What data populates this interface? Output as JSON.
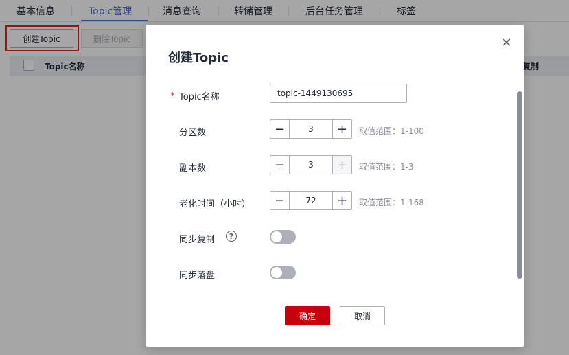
{
  "tabs": [
    {
      "label": "基本信息",
      "active": false
    },
    {
      "label": "Topic管理",
      "active": true
    },
    {
      "label": "消息查询",
      "active": false
    },
    {
      "label": "转储管理",
      "active": false
    },
    {
      "label": "后台任务管理",
      "active": false
    },
    {
      "label": "标签",
      "active": false
    }
  ],
  "toolbar": {
    "create_label": "创建Topic",
    "delete_label": "删除Topic"
  },
  "table": {
    "columns": [
      "Topic名称",
      "复制"
    ]
  },
  "dialog": {
    "title": "创建Topic",
    "close_icon": "close-icon",
    "fields": {
      "name": {
        "label": "Topic名称",
        "value": "topic-1449130695",
        "required": true
      },
      "partitions": {
        "label": "分区数",
        "value": "3",
        "hint": "取值范围：1-100"
      },
      "replicas": {
        "label": "副本数",
        "value": "3",
        "hint": "取值范围：1-3"
      },
      "aging_time": {
        "label": "老化时间（小时）",
        "value": "72",
        "hint": "取值范围：1-168"
      },
      "sync_replication": {
        "label": "同步复制",
        "enabled": false,
        "help_icon": "help-icon"
      },
      "sync_flush": {
        "label": "同步落盘",
        "enabled": false
      }
    },
    "ok_label": "确定",
    "cancel_label": "取消"
  },
  "colors": {
    "accent": "#526ecc",
    "primary_button": "#c7000b",
    "highlight_box": "#e02020"
  }
}
